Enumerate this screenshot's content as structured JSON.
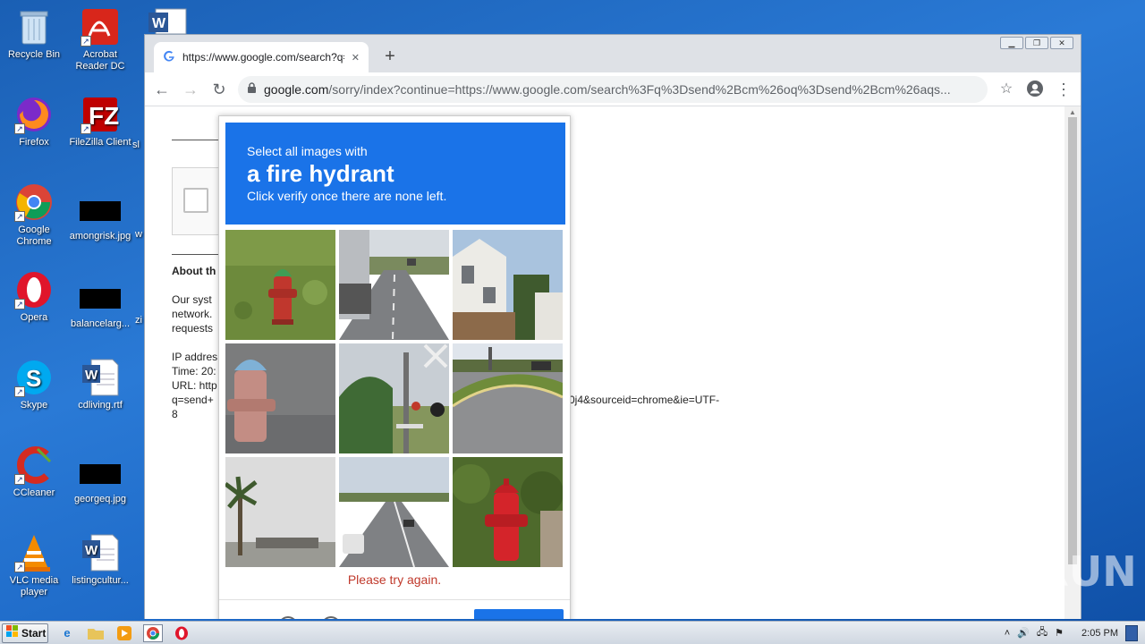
{
  "desktop": {
    "icons": [
      {
        "label": "Recycle Bin",
        "icon": "recycle-bin-icon"
      },
      {
        "label": "Acrobat Reader DC",
        "icon": "acrobat-icon"
      },
      {
        "label": "Firefox",
        "icon": "firefox-icon"
      },
      {
        "label": "FileZilla Client",
        "icon": "filezilla-icon"
      },
      {
        "label": "Google Chrome",
        "icon": "chrome-icon"
      },
      {
        "label": "amongrisk.jpg",
        "icon": "image-file-icon"
      },
      {
        "label": "Opera",
        "icon": "opera-icon"
      },
      {
        "label": "balancelarg...",
        "icon": "image-file-icon"
      },
      {
        "label": "Skype",
        "icon": "skype-icon"
      },
      {
        "label": "cdliving.rtf",
        "icon": "word-doc-icon"
      },
      {
        "label": "CCleaner",
        "icon": "ccleaner-icon"
      },
      {
        "label": "georgeq.jpg",
        "icon": "image-file-icon"
      },
      {
        "label": "VLC media player",
        "icon": "vlc-icon"
      },
      {
        "label": "listingcultur...",
        "icon": "word-doc-icon"
      }
    ],
    "partial_labels": [
      "sl",
      "w",
      "zi"
    ]
  },
  "browser": {
    "tab_title": "https://www.google.com/search?q=",
    "tab_close": "✕",
    "new_tab": "+",
    "url_host": "google.com",
    "url_rest": "/sorry/index?continue=https://www.google.com/search%3Fq%3Dsend%2Bcm%26oq%3Dsend%2Bcm%26aqs..."
  },
  "page": {
    "about_heading": "About th",
    "body_lines": [
      "Our syst",
      "network.",
      "requests"
    ],
    "info_lines": [
      "IP addres",
      "Time: 20:",
      "URL: http",
      "q=send+",
      "8"
    ],
    "url_tail": "0j4&sourceid=chrome&ie=UTF-"
  },
  "captcha": {
    "instruction_line1": "Select all images with",
    "target": "a fire hydrant",
    "instruction_line3": "Click verify once there are none left.",
    "error": "Please try again.",
    "tiles": [
      "hydrant-on-grass",
      "highway-truck",
      "white-house",
      "hydrant-closeup",
      "railroad-crossing",
      "parking-lot-curb",
      "palm-tree",
      "highway-cars",
      "red-hydrant-bush"
    ]
  },
  "watermark": "ANY RUN",
  "taskbar": {
    "start_label": "Start",
    "clock": "2:05 PM"
  }
}
